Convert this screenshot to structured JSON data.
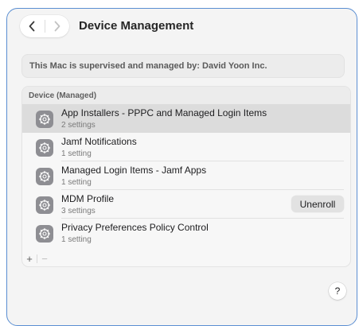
{
  "toolbar": {
    "title": "Device Management",
    "back_icon": "chevron-left-icon",
    "forward_icon": "chevron-right-icon"
  },
  "supervision": {
    "text": "This Mac is supervised and managed by: David Yoon Inc."
  },
  "device_panel": {
    "header": "Device (Managed)",
    "items": [
      {
        "name": "App Installers - PPPC and Managed Login Items",
        "detail": "2 settings",
        "selected": true
      },
      {
        "name": "Jamf Notifications",
        "detail": "1 setting",
        "selected": false
      },
      {
        "name": "Managed Login Items - Jamf Apps",
        "detail": "1 setting",
        "selected": false
      },
      {
        "name": "MDM Profile",
        "detail": "3 settings",
        "selected": false,
        "action_label": "Unenroll"
      },
      {
        "name": "Privacy Preferences Policy Control",
        "detail": "1 setting",
        "selected": false
      }
    ],
    "add_label": "+",
    "remove_label": "−"
  },
  "help": {
    "label": "?"
  },
  "colors": {
    "window_border": "#5a8ed2",
    "selected_row": "#dcdcdc",
    "profile_icon_bg": "#8e8e93"
  }
}
